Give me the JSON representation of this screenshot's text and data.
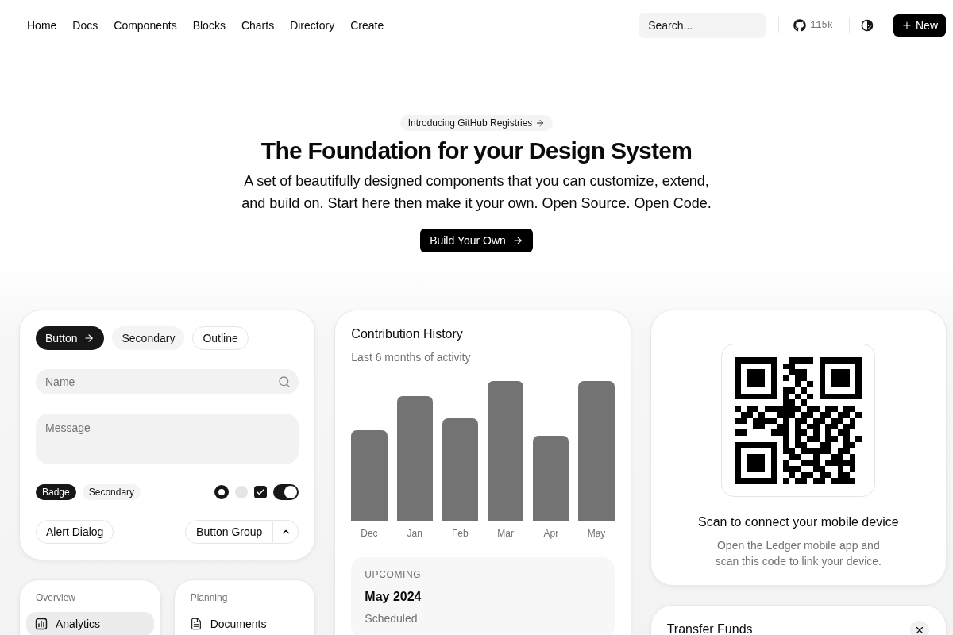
{
  "nav": {
    "links": [
      {
        "label": "Home"
      },
      {
        "label": "Docs"
      },
      {
        "label": "Components"
      },
      {
        "label": "Blocks"
      },
      {
        "label": "Charts"
      },
      {
        "label": "Directory"
      },
      {
        "label": "Create"
      }
    ],
    "search": {
      "label": "Search..."
    },
    "github_stars": "115k",
    "new_button": "New"
  },
  "hero": {
    "announcement": "Introducing GitHub Registries",
    "title": "The Foundation for your Design System",
    "subtitle": "A set of beautifully designed components that you can customize, extend, and build on. Start here then make it your own. Open Source. Open Code.",
    "cta": "Build Your Own"
  },
  "components_card": {
    "buttons": [
      {
        "label": "Button",
        "kind": "primary"
      },
      {
        "label": "Secondary",
        "kind": "secondary"
      },
      {
        "label": "Outline",
        "kind": "outline"
      }
    ],
    "name_field": {
      "placeholder": "Name"
    },
    "message_field": {
      "placeholder": "Message"
    },
    "badges": [
      {
        "label": "Badge",
        "kind": "primary"
      },
      {
        "label": "Secondary",
        "kind": "secondary"
      }
    ],
    "radios": [
      {
        "selected": true
      },
      {
        "selected": false
      }
    ],
    "checkbox": {
      "checked": true
    },
    "switch": {
      "on": true
    },
    "alert_dialog_button": "Alert Dialog",
    "button_group": {
      "label": "Button Group"
    }
  },
  "nav_cards": [
    {
      "heading": "Overview",
      "items": [
        {
          "label": "Analytics",
          "selected": true
        }
      ]
    },
    {
      "heading": "Planning",
      "items": [
        {
          "label": "Documents",
          "selected": false
        }
      ]
    }
  ],
  "contribution_card": {
    "title": "Contribution History",
    "subtitle": "Last 6 months of activity",
    "chart": {
      "months": [
        "Dec",
        "Jan",
        "Feb",
        "Mar",
        "Apr",
        "May"
      ]
    },
    "upcoming": {
      "label": "UPCOMING",
      "date": "May 2024",
      "status": "Scheduled"
    }
  },
  "qr_card": {
    "title": "Scan to connect your mobile device",
    "description": "Open the Ledger mobile app and scan this code to link your device."
  },
  "transfer_card": {
    "title": "Transfer Funds"
  }
}
